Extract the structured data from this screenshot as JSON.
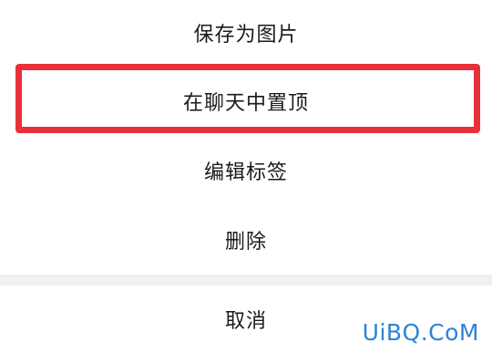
{
  "menu": {
    "save_image": "保存为图片",
    "pin_to_top": "在聊天中置顶",
    "edit_tags": "编辑标签",
    "delete": "删除",
    "cancel": "取消"
  },
  "watermark": "UiBQ.CoM",
  "colors": {
    "highlight": "#e8303a",
    "watermark": "#2d82d8"
  }
}
